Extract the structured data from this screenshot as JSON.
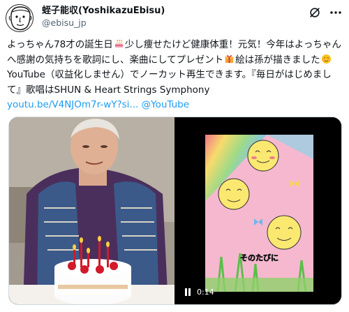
{
  "author": {
    "display_name": "蛭子能収(YoshikazuEbisu)",
    "handle": "@ebisu_jp",
    "avatar_icon": "caricature-avatar-icon"
  },
  "header_icons": [
    "grok-icon",
    "more-options-icon"
  ],
  "tweet": {
    "seg1": "よっちゃん78才の誕生日",
    "seg2": "少し痩せたけど健康体重！元気！今年はよっちゃんへ感謝の気持ちを歌詞にし、楽曲にしてプレゼント",
    "seg3": "絵は孫が描きました",
    "seg4": "YouTube（収益化しません）でノーカット再生できます。『毎日がはじめまして』歌唱はSHUN & Heart Strings Symphony",
    "link_text": "youtu.be/V4NJOm7r-wY?si...",
    "mention": "@YouTube",
    "emojis": [
      "birthday-cake-emoji",
      "gift-emoji",
      "smiling-face-emoji"
    ]
  },
  "media": {
    "photo_alt": "elderly-man-with-birthday-cake-photo",
    "video": {
      "time": "0:14",
      "caption_in_video": "そのたびに"
    }
  },
  "colors": {
    "link": "#1d9bf0",
    "secondary_text": "#536471",
    "border": "#cfd9de"
  }
}
